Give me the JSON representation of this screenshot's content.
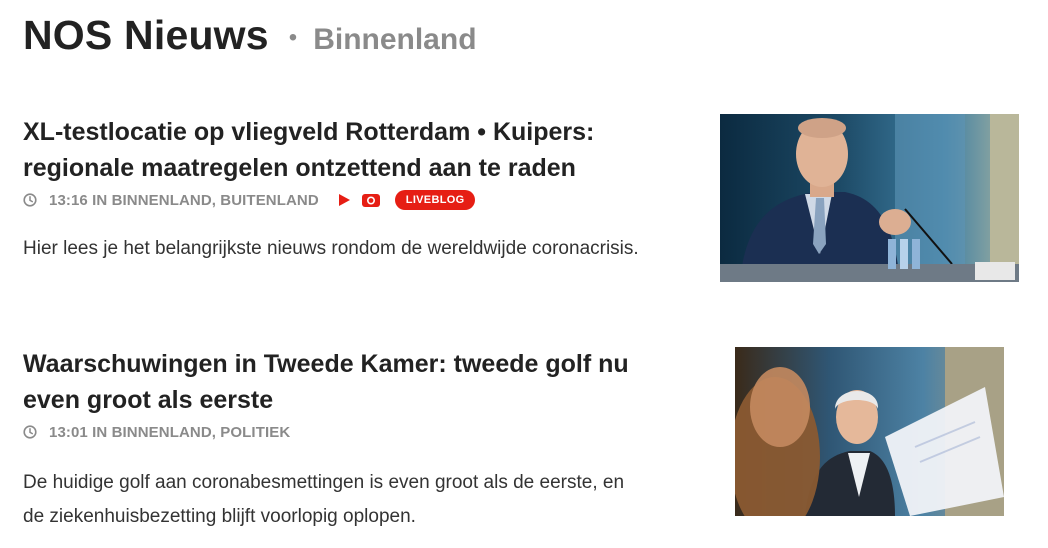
{
  "header": {
    "brand": "NOS Nieuws",
    "separator": "•",
    "section": "Binnenland"
  },
  "articles": [
    {
      "title": "XL-testlocatie op vliegveld Rotterdam • Kuipers: regionale maatregelen ontzettend aan te raden",
      "meta": "13:16 IN BINNENLAND, BUITENLAND",
      "badge": "LIVEBLOG",
      "lede": "Hier lees je het belangrijkste nieuws rondom de wereldwijde coronacrisis.",
      "icons": [
        "clock-icon",
        "play-icon",
        "camera-icon"
      ]
    },
    {
      "title": "Waarschuwingen in Tweede Kamer: tweede golf nu even groot als eerste",
      "meta": "13:01 IN BINNENLAND, POLITIEK",
      "lede": "De huidige golf aan coronabesmettingen is even groot als de eerste, en de ziekenhuisbezetting blijft voorlopig oplopen.",
      "icons": [
        "clock-icon"
      ]
    }
  ],
  "colors": {
    "accent": "#e61e14",
    "meta_gray": "#8a8a8a",
    "title": "#222222"
  }
}
